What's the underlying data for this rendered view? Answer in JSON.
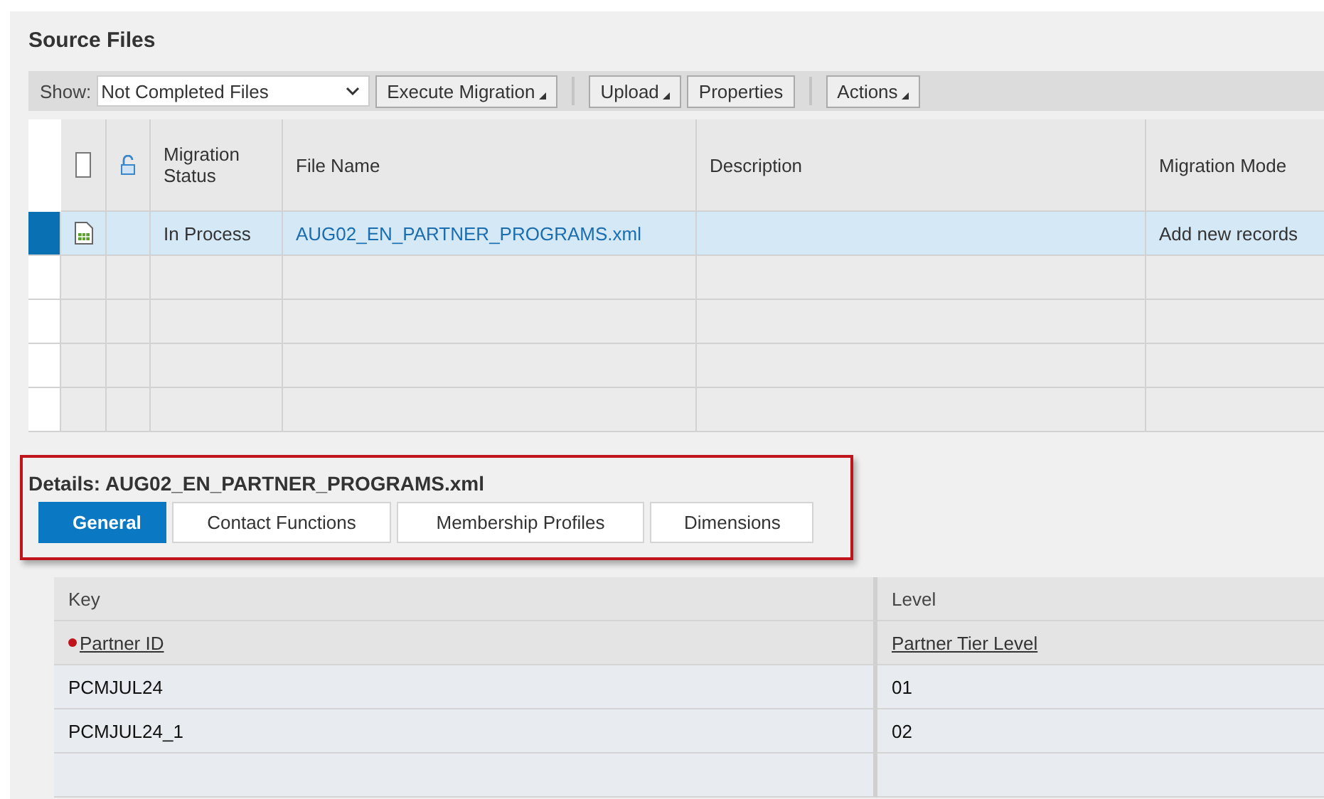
{
  "title": "Source Files",
  "toolbar": {
    "show_label": "Show:",
    "filter": "Not Completed Files",
    "buttons": [
      {
        "label": "Execute Migration",
        "menu": true
      },
      {
        "label": "Upload",
        "menu": true
      },
      {
        "label": "Properties",
        "menu": false
      },
      {
        "label": "Actions",
        "menu": true
      }
    ]
  },
  "table": {
    "all_checked": false,
    "columns": [
      "Migration Status",
      "File Name",
      "Description",
      "Migration Mode"
    ],
    "rows": [
      {
        "selected": true,
        "status": "In Process",
        "file_name": "AUG02_EN_PARTNER_PROGRAMS.xml",
        "mode": "Add new records"
      }
    ]
  },
  "details": {
    "title": "Details: AUG02_EN_PARTNER_PROGRAMS.xml",
    "tabs": [
      {
        "label": "General",
        "selected": true
      },
      {
        "label": "Contact Functions",
        "selected": false
      },
      {
        "label": "Membership Profiles",
        "selected": false
      },
      {
        "label": "Dimensions",
        "selected": false
      }
    ],
    "table": {
      "columns": [
        "Key",
        "Level"
      ],
      "fields": [
        {
          "label": "Partner ID",
          "required": true
        },
        {
          "label": "Partner Tier Level",
          "required": false
        }
      ],
      "rows": [
        [
          "PCMJUL24",
          "01"
        ],
        [
          "PCMJUL24_1",
          "02"
        ]
      ]
    }
  }
}
